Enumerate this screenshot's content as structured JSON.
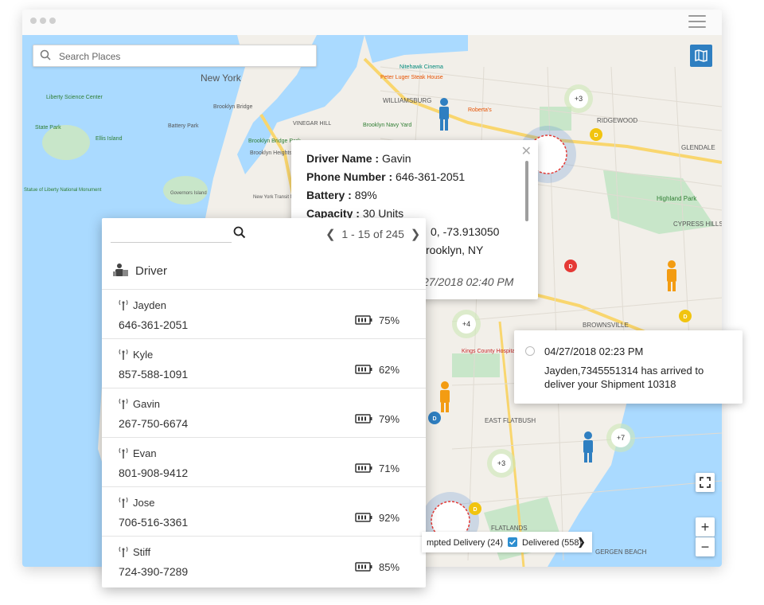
{
  "search": {
    "placeholder": "Search Places"
  },
  "map_labels": [
    "New York",
    "Liberty Science Center",
    "State Park",
    "Ellis Island",
    "Statue of Liberty National Monument",
    "Governors Island",
    "Battery Park",
    "Brooklyn Bridge",
    "WILLIAMSBURG",
    "VINEGAR HILL",
    "Brooklyn Navy Yard",
    "Peter Luger Steak House",
    "Roberta's",
    "Nitehawk Cinema",
    "RIDGEWOOD",
    "GLENDALE",
    "Highland Park",
    "CYPRESS HILLS",
    "BROWNSVILLE",
    "Kings County Hospital",
    "EAST FLATBUSH",
    "FLATLANDS",
    "GERGEN BEACH",
    "Brooklyn Heights",
    "Brooklyn Bridge Park",
    "New York Transit Museum"
  ],
  "clusters": [
    "+3",
    "+4",
    "+3",
    "+7"
  ],
  "popup": {
    "name_label": "Driver Name :",
    "name_value": "Gavin",
    "phone_label": "Phone Number :",
    "phone_value": "646-361-2051",
    "battery_label": "Battery :",
    "battery_value": "89%",
    "capacity_label": "Capacity :",
    "capacity_value": "30 Units",
    "coords_partial": "0, -73.913050",
    "address_partial": "t, Brooklyn, NY",
    "date_partial": "27/2018 02:40 PM"
  },
  "panel": {
    "pager_text": "1 - 15 of 245",
    "header": "Driver",
    "drivers": [
      {
        "name": "Jayden",
        "phone": "646-361-2051",
        "battery": "75%"
      },
      {
        "name": "Kyle",
        "phone": "857-588-1091",
        "battery": "62%"
      },
      {
        "name": "Gavin",
        "phone": "267-750-6674",
        "battery": "79%"
      },
      {
        "name": "Evan",
        "phone": "801-908-9412",
        "battery": "71%"
      },
      {
        "name": "Jose",
        "phone": "706-516-3361",
        "battery": "92%"
      },
      {
        "name": "Stiff",
        "phone": "724-390-7289",
        "battery": "85%"
      }
    ]
  },
  "legend": {
    "attempted": "mpted Delivery (24)",
    "delivered": "Delivered (558)"
  },
  "notification": {
    "timestamp": "04/27/2018 02:23 PM",
    "message": "Jayden,7345551314 has arrived to deliver your Shipment 10318"
  },
  "controls": {
    "zoom_in": "+",
    "zoom_out": "−"
  },
  "colors": {
    "water": "#aadaff",
    "land": "#f2efe9",
    "park": "#c8e6c9",
    "highway": "#f9d66e",
    "accent": "#2d8ed0",
    "driver_blue": "#2f7fc1",
    "driver_orange": "#f39c12",
    "marker_red": "#e53935",
    "marker_yellow": "#f1c40f"
  }
}
